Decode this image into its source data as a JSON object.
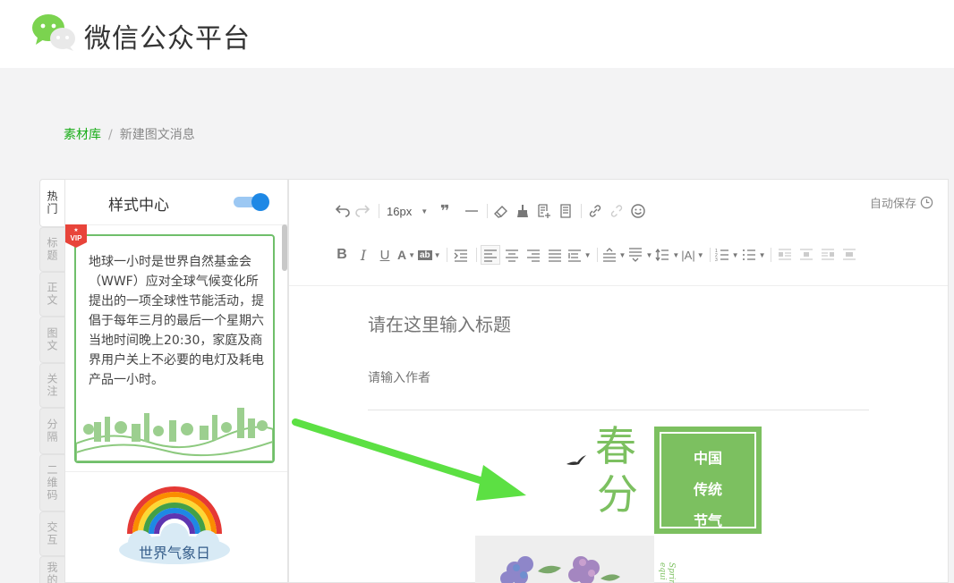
{
  "header": {
    "logo_text": "微信公众平台"
  },
  "breadcrumb": {
    "root": "素材库",
    "separator": "/",
    "current": "新建图文消息"
  },
  "side_tabs": [
    "热门",
    "标题",
    "正文",
    "图文",
    "关注",
    "分隔",
    "二维码",
    "交互",
    "我的"
  ],
  "style_panel": {
    "title": "样式中心",
    "toggle_on": true,
    "card1": {
      "badge": "VIP",
      "text": "地球一小时是世界自然基金会（WWF）应对全球气候变化所提出的一项全球性节能活动，提倡于每年三月的最后一个星期六当地时间晚上20:30，家庭及商界用户关上不必要的电灯及耗电产品一小时。"
    },
    "card2": {
      "label": "世界气象日"
    }
  },
  "editor": {
    "autosave_label": "自动保存",
    "font_size": "16px",
    "title_placeholder": "请在这里输入标题",
    "author_placeholder": "请输入作者",
    "content": {
      "chun": "春",
      "fen": "分",
      "box_lines": [
        "中国",
        "传统",
        "节气"
      ],
      "vertical_text": "Spring equi"
    }
  },
  "colors": {
    "brand_green": "#1aad19",
    "accent_green": "#7cc060",
    "toggle_blue": "#1e88e5",
    "arrow_green": "#5ce043"
  }
}
